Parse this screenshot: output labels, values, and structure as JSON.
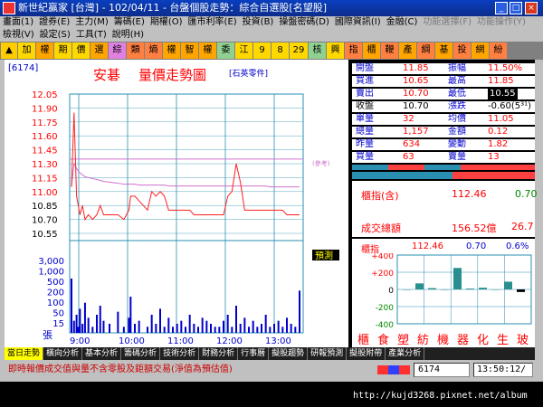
{
  "window": {
    "title": "新世紀贏家 [台灣] - 102/04/11 - 台盤個股走勢：綜合自選股[名望股]"
  },
  "menu1": [
    "畫面(1)",
    "證券(E)",
    "主力(M)",
    "籌碼(E)",
    "期權(O)",
    "匯市利率(E)",
    "投資(B)",
    "操盤密碼(D)",
    "國際資訊(I)",
    "金融(C)",
    "功能選擇(F)",
    "功能操作(Y)"
  ],
  "menu2": [
    "檢視(V)",
    "設定(S)",
    "工具(T)",
    "說明(H)"
  ],
  "toolbar": [
    "加",
    "權",
    "期",
    "價",
    "選",
    "綜",
    "類",
    "熵",
    "權",
    "智",
    "權",
    "委",
    "江",
    "9",
    "8",
    "29",
    "核",
    "興",
    "指",
    "櫃",
    "鞭",
    "產",
    "綱",
    "基",
    "投",
    "網",
    "紛"
  ],
  "chart": {
    "code": "[6174]",
    "name": "安碁",
    "chart_title": "量價走勢圖",
    "industry": "[石英零件]",
    "ref_label": "(參考)",
    "forecast_label": "預測",
    "vol_unit": "張"
  },
  "chart_data": {
    "type": "line",
    "price_ticks": [
      "12.05",
      "11.90",
      "11.75",
      "11.60",
      "11.45",
      "11.30",
      "11.15",
      "11.00",
      "10.85",
      "10.70",
      "10.55"
    ],
    "vol_ticks": [
      "3,000",
      "1,000",
      "500",
      "200",
      "100",
      "50",
      "15"
    ],
    "time_ticks": [
      "9:00",
      "10:00",
      "11:00",
      "12:00",
      "13:00"
    ],
    "ylim": [
      10.55,
      12.05
    ],
    "reference_price": 11.35,
    "x": [
      0,
      3,
      6,
      8,
      10,
      13,
      16,
      20,
      25,
      30,
      34,
      38,
      45,
      55,
      62,
      68,
      70,
      75,
      80,
      90,
      95,
      100,
      105,
      110,
      115,
      120,
      125,
      130,
      135,
      140,
      145,
      150,
      155,
      160,
      165,
      170,
      175,
      180,
      185,
      190,
      195,
      200,
      205,
      210,
      215,
      220,
      225,
      230,
      235,
      240,
      245,
      250,
      255,
      260,
      265,
      270
    ],
    "price": [
      11.05,
      11.85,
      10.95,
      10.85,
      10.75,
      10.85,
      10.7,
      10.75,
      10.7,
      10.75,
      10.85,
      10.75,
      10.75,
      10.75,
      10.7,
      10.8,
      10.95,
      10.95,
      10.9,
      10.8,
      11.0,
      10.95,
      11.0,
      10.95,
      10.8,
      10.8,
      10.8,
      10.8,
      10.8,
      10.8,
      10.75,
      10.75,
      10.75,
      10.75,
      10.75,
      10.75,
      10.75,
      10.75,
      10.95,
      11.0,
      11.3,
      11.1,
      10.8,
      10.8,
      10.8,
      10.8,
      10.8,
      10.8,
      10.8,
      10.8,
      10.8,
      10.8,
      10.75,
      10.75,
      10.75,
      10.75
    ],
    "avg": [
      11.05,
      11.3,
      11.25,
      11.22,
      11.2,
      11.18,
      11.16,
      11.15,
      11.14,
      11.13,
      11.12,
      11.11,
      11.1,
      11.09,
      11.08,
      11.08,
      11.08,
      11.08,
      11.07,
      11.07,
      11.07,
      11.07,
      11.07,
      11.07,
      11.06,
      11.06,
      11.06,
      11.06,
      11.06,
      11.06,
      11.06,
      11.06,
      11.06,
      11.06,
      11.06,
      11.06,
      11.06,
      11.06,
      11.06,
      11.06,
      11.06,
      11.06,
      11.06,
      11.06,
      11.06,
      11.06,
      11.06,
      11.06,
      11.05,
      11.05,
      11.05,
      11.05,
      11.05,
      11.05,
      11.05,
      11.05
    ],
    "volume": [
      18,
      4,
      6,
      2,
      8,
      3,
      10,
      5,
      2,
      6,
      9,
      4,
      3,
      7,
      2,
      5,
      12,
      3,
      4,
      2,
      6,
      3,
      8,
      2,
      5,
      2,
      3,
      4,
      2,
      6,
      3,
      2,
      5,
      4,
      3,
      2,
      2,
      4,
      6,
      2,
      9,
      3,
      5,
      2,
      4,
      2,
      3,
      6,
      2,
      3,
      4,
      2,
      5,
      3,
      2,
      14
    ]
  },
  "quote": {
    "rows": [
      {
        "l1": "開盤",
        "v1": "11.85",
        "l2": "振幅",
        "v2": "11.50%"
      },
      {
        "l1": "買進",
        "v1": "10.65",
        "l2": "最高",
        "v2": "11.85"
      },
      {
        "l1": "賣出",
        "v1": "10.70",
        "l2": "最低",
        "v2": "10.55"
      },
      {
        "l1": "收盤",
        "v1": "10.70",
        "l2": "漲跌",
        "v2": "-0.60(5³¹)"
      },
      {
        "l1": "單量",
        "v1": "32",
        "l2": "均價",
        "v2": "11.05"
      },
      {
        "l1": "總量",
        "v1": "1,157",
        "l2": "金額",
        "v2": "0.12"
      },
      {
        "l1": "昨量",
        "v1": "634",
        "l2": "變動",
        "v2": "1.82"
      },
      {
        "l1": "買量",
        "v1": "63",
        "l2": "賣量",
        "v2": "13"
      }
    ]
  },
  "otc": {
    "index_label": "櫃指(含)",
    "index_value": "112.46",
    "index_change": "0.70",
    "turnover_label": "成交總額",
    "turnover_value": "156.52億",
    "turnover_change": "26.7"
  },
  "sector": {
    "label": "櫃指",
    "value": "112.46",
    "change": "0.70",
    "pct": "0.6%",
    "ticks": [
      "+400",
      "+200",
      "0",
      "-200",
      "-400"
    ],
    "names": [
      "櫃",
      "食",
      "塑",
      "紡",
      "機",
      "器",
      "化",
      "生",
      "玻"
    ],
    "values": [
      0,
      70,
      15,
      0,
      250,
      10,
      20,
      0,
      90,
      -30
    ]
  },
  "tabs": [
    "當日走勢",
    "橫向分析",
    "基本分析",
    "籌碼分析",
    "技術分析",
    "財務分析",
    "行事曆",
    "擬股趨勢",
    "研報預測",
    "擬股附帶",
    "產業分析"
  ],
  "status": {
    "message": "即時報價成交值與量不含零股及鉅額交易(淨值為預估值)",
    "code": "6174",
    "time": "13:50:12/"
  },
  "watermark": "http://kujd3268.pixnet.net/album",
  "colors": {
    "up": "#ff0000",
    "down": "#008800",
    "accent": "#0000ff",
    "ref": "#d070d0"
  }
}
